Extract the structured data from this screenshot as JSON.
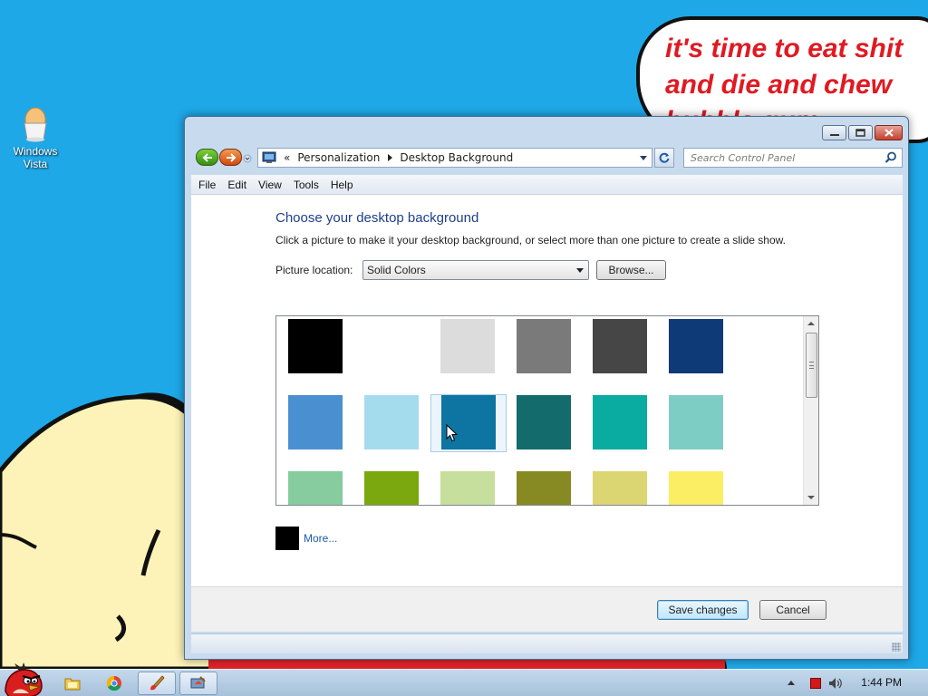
{
  "desktop": {
    "icon_label_line1": "Windows",
    "icon_label_line2": "Vista",
    "speech_bubble_line1": "it's time to eat shit",
    "speech_bubble_line2": "and die and chew",
    "speech_bubble_line3": "bubble gum"
  },
  "window": {
    "nav": {
      "chevron": "«",
      "breadcrumb": [
        "Personalization",
        "Desktop Background"
      ],
      "search_placeholder": "Search Control Panel"
    },
    "menu": [
      "File",
      "Edit",
      "View",
      "Tools",
      "Help"
    ],
    "heading": "Choose your desktop background",
    "description": "Click a picture to make it your desktop background, or select more than one picture to create a slide show.",
    "picture_location_label": "Picture location:",
    "picture_location_value": "Solid Colors",
    "browse_label": "Browse...",
    "swatches": [
      "#000000",
      "#ffffff",
      "#dcdcdc",
      "#7a7a7a",
      "#464646",
      "#0e3a78",
      "#4a90d0",
      "#a4dcee",
      "#0e74a2",
      "#136b6b",
      "#0aaba0",
      "#7ecdc4",
      "#86cc9e",
      "#7aa80e",
      "#c6df9c",
      "#878a22",
      "#dcd672",
      "#fcee64"
    ],
    "selected_swatch_index": 8,
    "more_label": "More...",
    "more_swatch_color": "#000000",
    "save_label": "Save changes",
    "cancel_label": "Cancel"
  },
  "taskbar": {
    "clock": "1:44 PM"
  }
}
